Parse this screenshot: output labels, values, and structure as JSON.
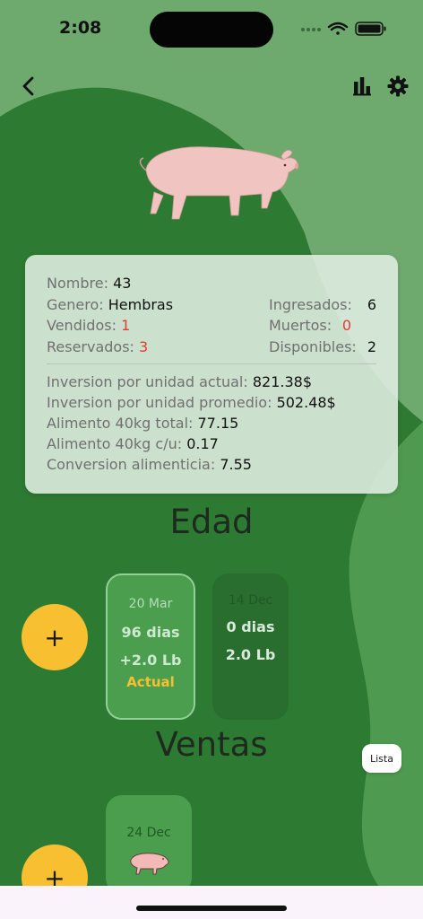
{
  "status": {
    "time": "2:08"
  },
  "nav": {
    "back_icon": "chevron-left-icon",
    "stats_icon": "bar-chart-icon",
    "settings_icon": "gear-icon"
  },
  "colors": {
    "accent": "#f8c030",
    "primary_green": "#2c7a33",
    "light_green": "#4a9e4e",
    "red": "#e53935"
  },
  "info": {
    "nombre_label": "Nombre:",
    "nombre_value": "43",
    "genero_label": "Genero:",
    "genero_value": "Hembras",
    "ingresados_label": "Ingresados:",
    "ingresados_value": "6",
    "vendidos_label": "Vendidos:",
    "vendidos_value": "1",
    "muertos_label": "Muertos:",
    "muertos_value": "0",
    "reservados_label": "Reservados:",
    "reservados_value": "3",
    "disponibles_label": "Disponibles:",
    "disponibles_value": "2",
    "inv_actual_label": "Inversion por unidad actual:",
    "inv_actual_value": "821.38$",
    "inv_prom_label": "Inversion por unidad promedio:",
    "inv_prom_value": "502.48$",
    "alim_total_label": "Alimento 40kg total:",
    "alim_total_value": "77.15",
    "alim_cu_label": "Alimento 40kg c/u:",
    "alim_cu_value": "0.17",
    "conv_label": "Conversion alimenticia:",
    "conv_value": "7.55"
  },
  "edad": {
    "title": "Edad",
    "add_label": "+",
    "cards": [
      {
        "date": "20 Mar",
        "days": "96 dias",
        "weight": "+2.0 Lb",
        "tag": "Actual"
      },
      {
        "date": "14 Dec",
        "days": "0 dias",
        "weight": "2.0 Lb"
      }
    ]
  },
  "ventas": {
    "title": "Ventas",
    "add_label": "+",
    "lista_label": "Lista",
    "cards": [
      {
        "date": "24 Dec",
        "icon": "pig-icon"
      }
    ]
  }
}
